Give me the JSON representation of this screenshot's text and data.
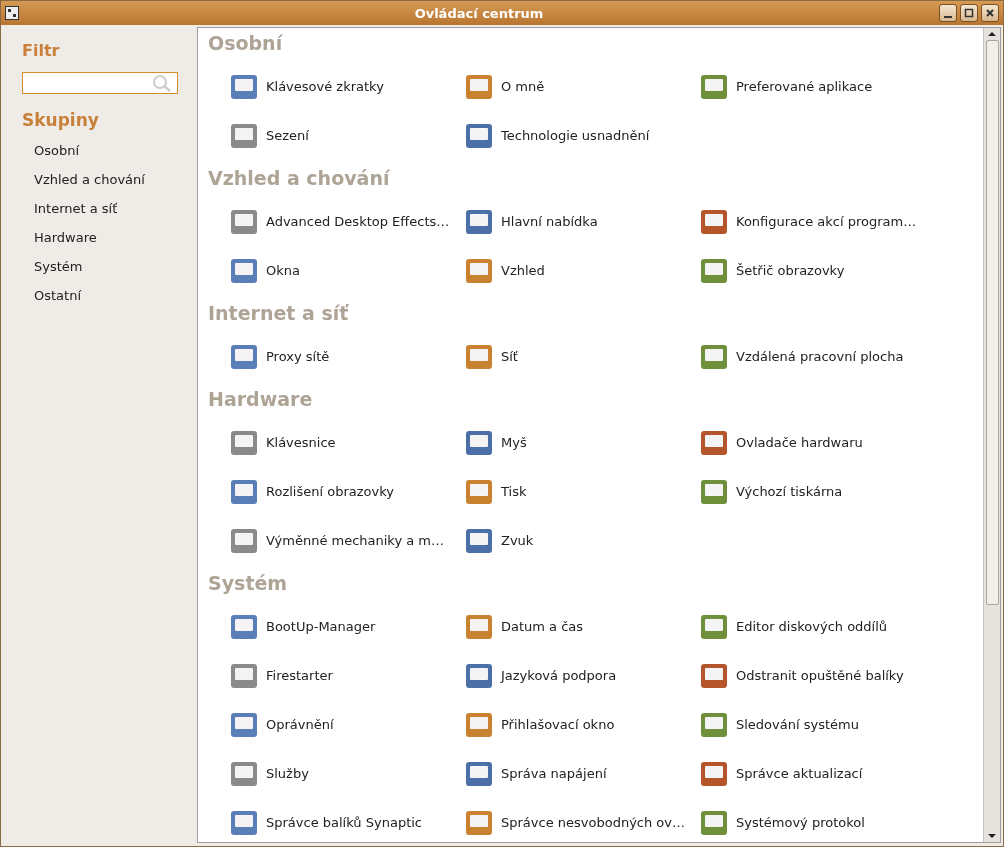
{
  "window": {
    "title": "Ovládací centrum"
  },
  "sidebar": {
    "filter_title": "Filtr",
    "groups_title": "Skupiny",
    "items": [
      "Osobní",
      "Vzhled a chování",
      "Internet a síť",
      "Hardware",
      "Systém",
      "Ostatní"
    ]
  },
  "sections": [
    {
      "title": "Osobní",
      "items": [
        "Klávesové zkratky",
        "O mně",
        "Preferované aplikace",
        "Sezení",
        "Technologie usnadnění"
      ]
    },
    {
      "title": "Vzhled a chování",
      "items": [
        "Advanced Desktop Effects…",
        "Hlavní nabídka",
        "Konfigurace akcí program…",
        "Okna",
        "Vzhled",
        "Šetřič obrazovky"
      ]
    },
    {
      "title": "Internet a síť",
      "items": [
        "Proxy sítě",
        "Síť",
        "Vzdálená pracovní plocha"
      ]
    },
    {
      "title": "Hardware",
      "items": [
        "Klávesnice",
        "Myš",
        "Ovladače hardwaru",
        "Rozlišení obrazovky",
        "Tisk",
        "Výchozí tiskárna",
        "Výměnné mechaniky a m…",
        "Zvuk"
      ]
    },
    {
      "title": "Systém",
      "items": [
        "BootUp-Manager",
        "Datum a čas",
        "Editor diskových oddílů",
        "Firestarter",
        "Jazyková podpora",
        "Odstranit opuštěné balíky",
        "Oprávnění",
        "Přihlašovací okno",
        "Sledování systému",
        "Služby",
        "Správa napájení",
        "Správce aktualizací",
        "Správce balíků Synaptic",
        "Správce nesvobodných ov…",
        "Systémový protokol"
      ]
    }
  ]
}
